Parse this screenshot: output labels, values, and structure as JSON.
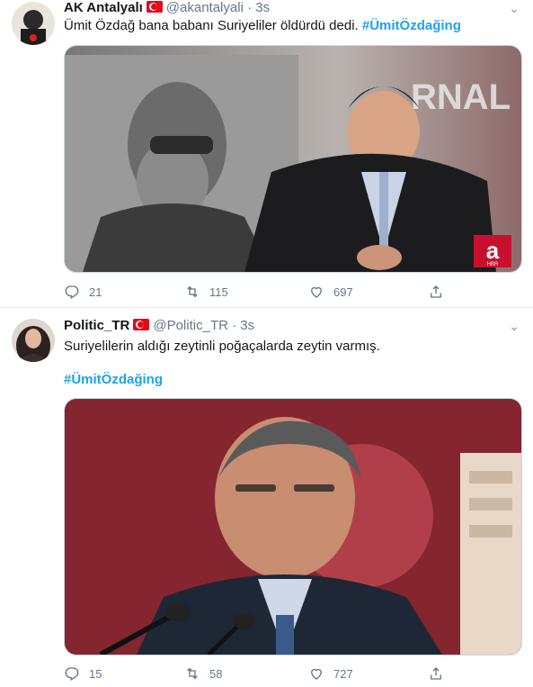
{
  "tweets": [
    {
      "name": "AK Antalyalı",
      "handle": "@akantalyali",
      "dot": "·",
      "time": "3s",
      "text": "Ümit Özdağ bana babanı Suriyeliler öldürdü dedi.",
      "hashtag": "#ÜmitÖzdağing",
      "media": {
        "overlay_text": "RNAL",
        "channel_logo": "a",
        "channel_sub": "HBR"
      },
      "replies": "21",
      "retweets": "115",
      "likes": "697"
    },
    {
      "name": "Politic_TR",
      "handle": "@Politic_TR",
      "dot": "·",
      "time": "3s",
      "text": "Suriyelilerin aldığı zeytinli poğaçalarda zeytin varmış.",
      "hashtag": "#ÜmitÖzdağing",
      "replies": "15",
      "retweets": "58",
      "likes": "727"
    }
  ],
  "icons": {
    "reply": "reply-icon",
    "retweet": "retweet-icon",
    "like": "heart-icon",
    "share": "share-icon",
    "more": "chevron-down-icon"
  },
  "colors": {
    "hashtag": "#1da1f2",
    "meta": "#657786",
    "flag": "#e30a17"
  }
}
